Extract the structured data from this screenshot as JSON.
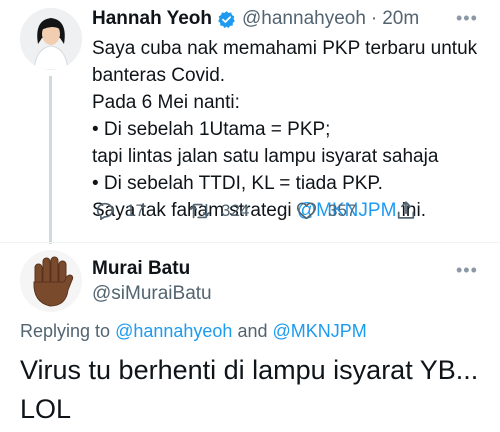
{
  "tweet1": {
    "name": "Hannah Yeoh",
    "handle": "@hannahyeoh",
    "dot": "·",
    "time": "20m",
    "more": "•••",
    "lines": [
      "Saya cuba nak memahami PKP terbaru untuk",
      "banteras Covid.",
      "Pada 6 Mei nanti:",
      "• Di sebelah 1Utama = PKP;",
      "tapi lintas jalan satu lampu isyarat sahaja",
      "• Di sebelah TTDI, KL = tiada PKP."
    ],
    "last_line_prefix": "Saya tak faham strategi ",
    "last_line_mention": "@MKNJPM",
    "last_line_suffix": " ini.",
    "replies": "17",
    "retweets": "324",
    "likes": "357",
    "icons": [
      "verified-badge",
      "reply-icon",
      "retweet-icon",
      "like-icon",
      "share-icon"
    ]
  },
  "tweet2": {
    "name": "Murai Batu",
    "handle": "@siMuraiBatu",
    "more": "•••",
    "replying_prefix": "Replying to ",
    "replying_mention1": "@hannahyeoh",
    "replying_and": " and ",
    "replying_mention2": "@MKNJPM",
    "text_line1": "Virus tu berhenti di lampu isyarat YB...",
    "text_line2": "LOL"
  },
  "colors": {
    "accent": "#1d9bf0",
    "text": "#0f1419",
    "secondary": "#536471"
  }
}
